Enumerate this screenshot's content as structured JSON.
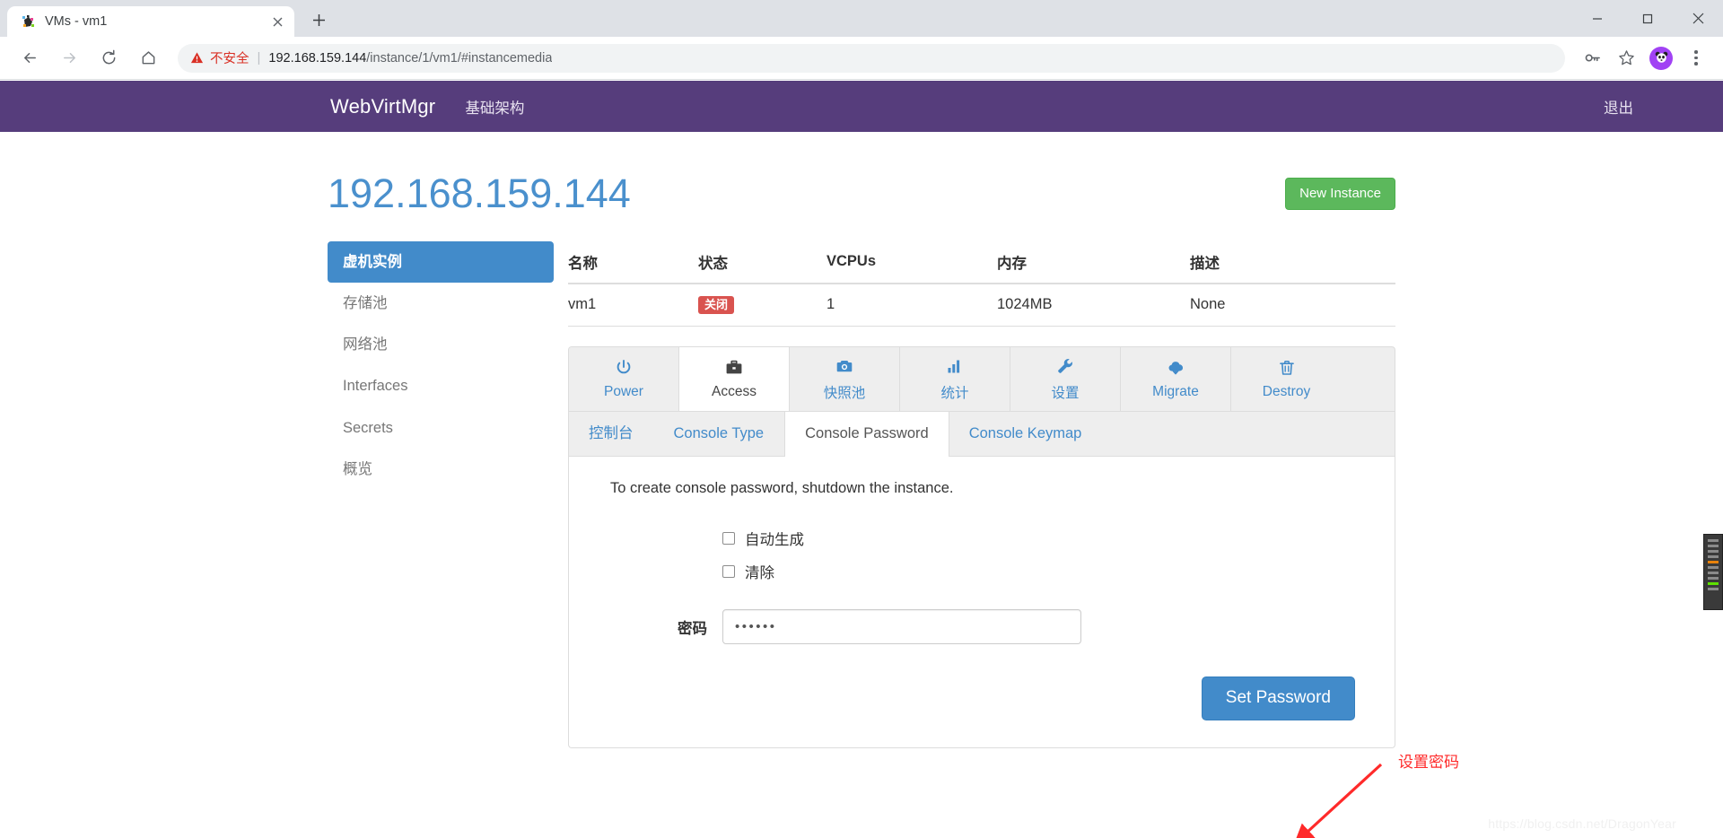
{
  "browser": {
    "tab": {
      "title": "VMs - vm1",
      "favicon_icon": "vm-favicon",
      "close_icon": "close-icon"
    },
    "newtab_label": "+",
    "window_controls": {
      "minimize": "minimize-icon",
      "maximize": "maximize-icon",
      "close": "close-icon"
    },
    "nav": {
      "back": "back-arrow-icon",
      "forward": "forward-arrow-icon",
      "reload": "reload-icon",
      "home": "home-icon"
    },
    "omnibox": {
      "warning_icon": "warning-triangle-icon",
      "warning_text": "不安全",
      "separator": "|",
      "url_host": "192.168.159.144",
      "url_path": "/instance/1/vm1/#instancemedia"
    },
    "toolbar_icons": {
      "password_key": "key-icon",
      "bookmark": "star-icon",
      "profile": "panda-avatar",
      "menu": "three-dots-icon"
    }
  },
  "navbar": {
    "brand": "WebVirtMgr",
    "links": [
      {
        "label": "基础架构"
      }
    ],
    "logout_label": "退出",
    "bg_color": "#563d7c"
  },
  "page": {
    "title": "192.168.159.144",
    "title_color": "#4a90cd",
    "new_instance_label": "New Instance",
    "new_instance_color": "#5cb85c"
  },
  "sidebar": {
    "items": [
      {
        "label": "虚机实例",
        "active": true
      },
      {
        "label": "存储池",
        "active": false
      },
      {
        "label": "网络池",
        "active": false
      },
      {
        "label": "Interfaces",
        "active": false
      },
      {
        "label": "Secrets",
        "active": false
      },
      {
        "label": "概览",
        "active": false
      }
    ],
    "active_color": "#428bca"
  },
  "vm_table": {
    "headers": [
      "名称",
      "状态",
      "VCPUs",
      "内存",
      "描述"
    ],
    "rows": [
      {
        "name": "vm1",
        "state": "关闭",
        "vcpus": "1",
        "memory": "1024MB",
        "description": "None"
      }
    ],
    "state_badge_color": "#d9534f"
  },
  "icon_tabs": [
    {
      "label": "Power",
      "icon": "power-icon",
      "active": false
    },
    {
      "label": "Access",
      "icon": "briefcase-icon",
      "active": true
    },
    {
      "label": "快照池",
      "icon": "camera-icon",
      "active": false
    },
    {
      "label": "统计",
      "icon": "bar-chart-icon",
      "active": false
    },
    {
      "label": "设置",
      "icon": "wrench-icon",
      "active": false
    },
    {
      "label": "Migrate",
      "icon": "cloud-download-icon",
      "active": false
    },
    {
      "label": "Destroy",
      "icon": "trash-icon",
      "active": false
    }
  ],
  "sub_tabs": [
    {
      "label": "控制台",
      "active": false
    },
    {
      "label": "Console Type",
      "active": false
    },
    {
      "label": "Console Password",
      "active": true
    },
    {
      "label": "Console Keymap",
      "active": false
    }
  ],
  "form": {
    "lead_text": "To create console password, shutdown the instance.",
    "checkbox_auto_label": "自动生成",
    "checkbox_clear_label": "清除",
    "password_label": "密码",
    "password_value": "••••••",
    "submit_label": "Set Password",
    "submit_color": "#428bca"
  },
  "annotation": {
    "text": "设置密码",
    "color": "#ff2a2a"
  },
  "watermark": "https://blog.csdn.net/DragonYear"
}
